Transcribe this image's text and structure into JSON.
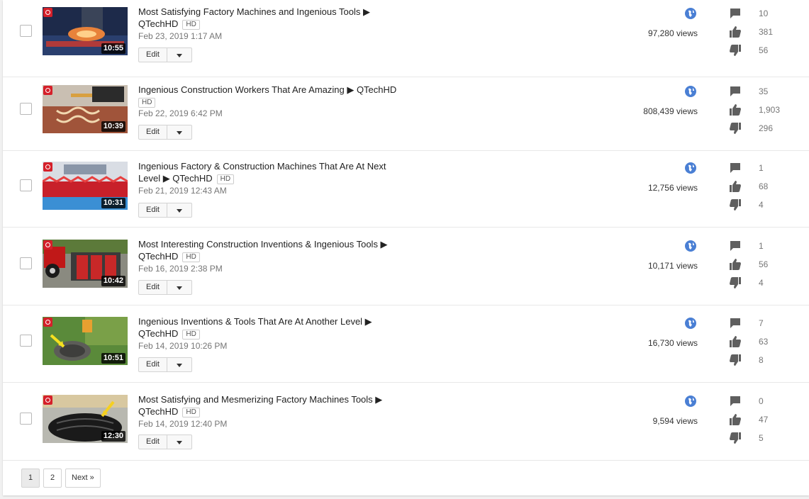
{
  "videos": [
    {
      "title_line1": "Most Satisfying Factory Machines and Ingenious Tools ▶",
      "title_line2": "QTechHD",
      "hd": "HD",
      "date": "Feb 23, 2019 1:17 AM",
      "duration": "10:55",
      "views": "97,280 views",
      "comments": "10",
      "likes": "381",
      "dislikes": "56",
      "edit_label": "Edit"
    },
    {
      "title_line1": "Ingenious Construction Workers That Are Amazing ▶ QTechHD",
      "title_line2": "",
      "hd": "HD",
      "date": "Feb 22, 2019 6:42 PM",
      "duration": "10:39",
      "views": "808,439 views",
      "comments": "35",
      "likes": "1,903",
      "dislikes": "296",
      "edit_label": "Edit"
    },
    {
      "title_line1": "Ingenious Factory & Construction Machines That Are At Next",
      "title_line2": "Level ▶ QTechHD",
      "hd": "HD",
      "date": "Feb 21, 2019 12:43 AM",
      "duration": "10:31",
      "views": "12,756 views",
      "comments": "1",
      "likes": "68",
      "dislikes": "4",
      "edit_label": "Edit"
    },
    {
      "title_line1": "Most Interesting Construction Inventions & Ingenious Tools ▶",
      "title_line2": "QTechHD",
      "hd": "HD",
      "date": "Feb 16, 2019 2:38 PM",
      "duration": "10:42",
      "views": "10,171 views",
      "comments": "1",
      "likes": "56",
      "dislikes": "4",
      "edit_label": "Edit"
    },
    {
      "title_line1": "Ingenious Inventions & Tools That Are At Another Level ▶",
      "title_line2": "QTechHD",
      "hd": "HD",
      "date": "Feb 14, 2019 10:26 PM",
      "duration": "10:51",
      "views": "16,730 views",
      "comments": "7",
      "likes": "63",
      "dislikes": "8",
      "edit_label": "Edit"
    },
    {
      "title_line1": "Most Satisfying and Mesmerizing Factory Machines Tools ▶",
      "title_line2": "QTechHD",
      "hd": "HD",
      "date": "Feb 14, 2019 12:40 PM",
      "duration": "12:30",
      "views": "9,594 views",
      "comments": "0",
      "likes": "47",
      "dislikes": "5",
      "edit_label": "Edit"
    }
  ],
  "pagination": {
    "page1": "1",
    "page2": "2",
    "next": "Next »"
  },
  "icons": {
    "visibility": "globe-icon",
    "comments": "comment-icon",
    "likes": "thumbs-up-icon",
    "dislikes": "thumbs-down-icon"
  },
  "colors": {
    "globe_blue": "#4a7fd4",
    "icon_gray": "#5f5f5f",
    "channel_badge_red": "#d5202a"
  }
}
